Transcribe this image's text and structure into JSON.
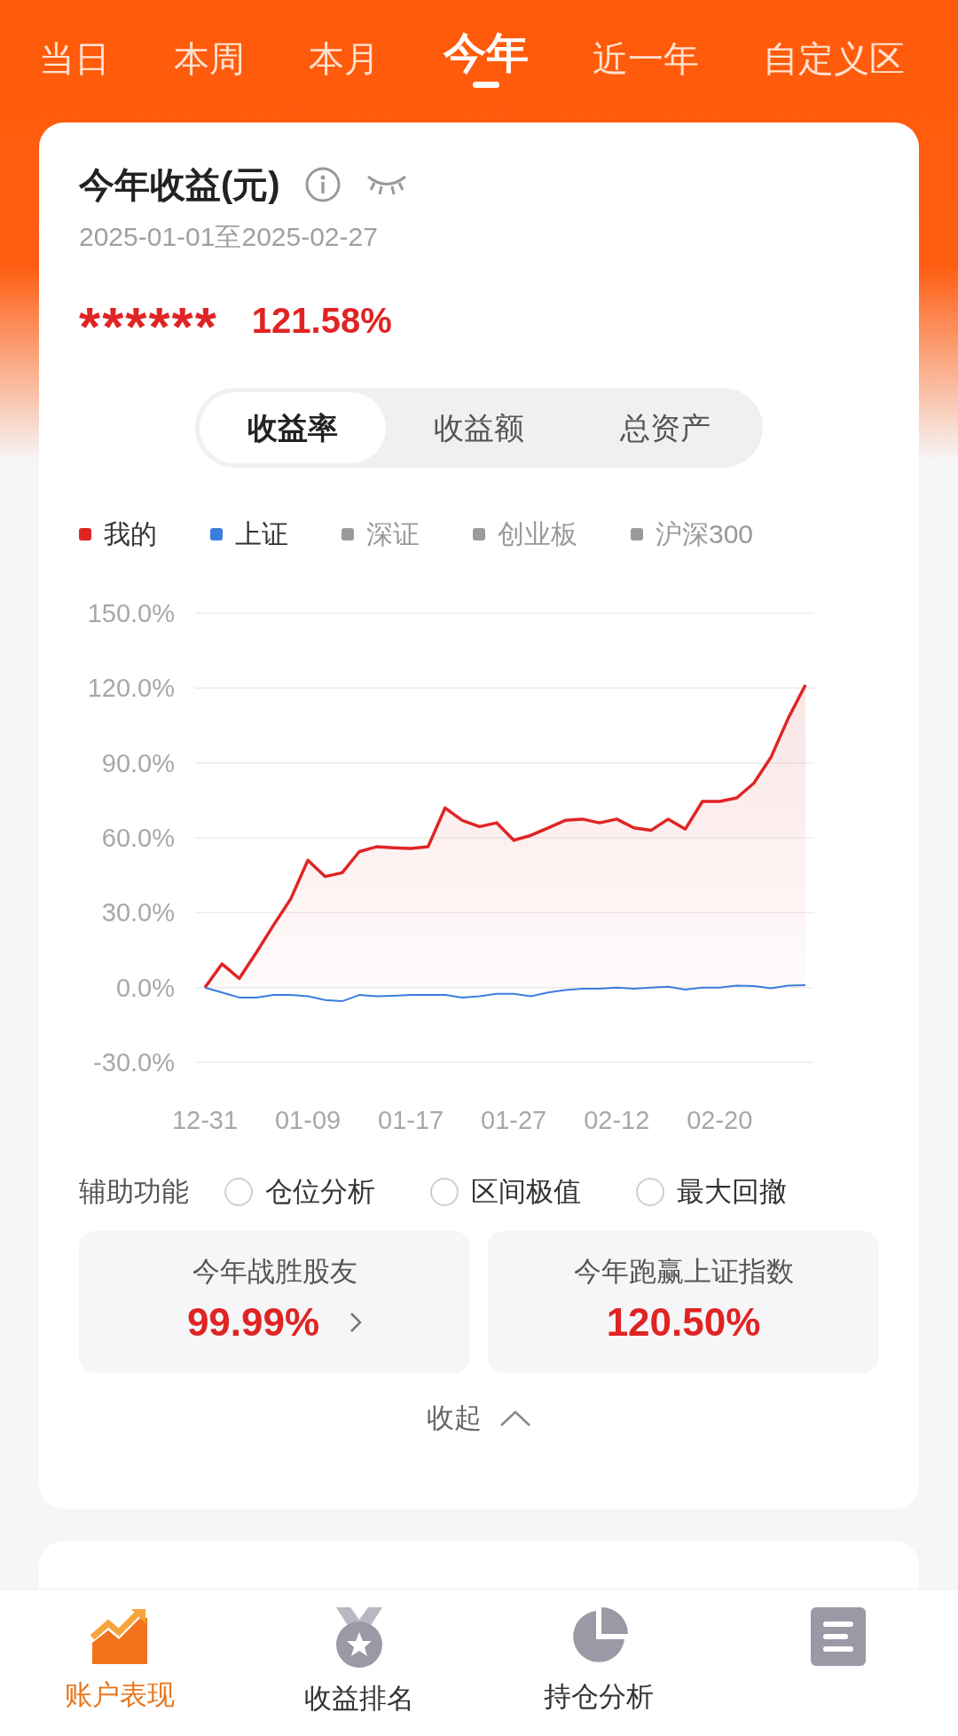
{
  "period_tabs": [
    {
      "label": "当日",
      "selected": false
    },
    {
      "label": "本周",
      "selected": false
    },
    {
      "label": "本月",
      "selected": false
    },
    {
      "label": "今年",
      "selected": true
    },
    {
      "label": "近一年",
      "selected": false
    },
    {
      "label": "自定义区",
      "selected": false
    }
  ],
  "summary": {
    "title": "今年收益(元)",
    "date_range": "2025-01-01至2025-02-27",
    "amount": "******",
    "rate": "121.58%"
  },
  "metric_tabs": [
    {
      "label": "收益率",
      "selected": true
    },
    {
      "label": "收益额",
      "selected": false
    },
    {
      "label": "总资产",
      "selected": false
    }
  ],
  "legend": [
    {
      "label": "深证",
      "color": "#9a9a9a"
    },
    {
      "label": "创业板",
      "color": "#9a9a9a"
    },
    {
      "label": "沪深300",
      "color": "#9a9a9a"
    }
  ],
  "chart": {
    "chart_data": {
      "type": "line",
      "grid": true,
      "categories": [
        "12-31",
        null,
        null,
        null,
        null,
        null,
        "01-09",
        null,
        null,
        null,
        null,
        null,
        "01-17",
        null,
        null,
        null,
        null,
        null,
        "01-27",
        null,
        null,
        null,
        null,
        null,
        "02-12",
        null,
        null,
        null,
        null,
        null,
        "02-20",
        null,
        null,
        null,
        null,
        null
      ],
      "ylim": [
        -30,
        150
      ],
      "yticks": [
        {
          "value": 150,
          "label": "150.0%"
        },
        {
          "value": 120,
          "label": "120.0%"
        },
        {
          "value": 90,
          "label": "90.0%"
        },
        {
          "value": 60,
          "label": "60.0%"
        },
        {
          "value": 30,
          "label": "30.0%"
        },
        {
          "value": 0,
          "label": "0.0%"
        },
        {
          "value": -30,
          "label": "-30.0%"
        }
      ],
      "series": [
        {
          "name": "我的",
          "type": "area",
          "color": "#e02424",
          "values": [
            0,
            9.5,
            3.6,
            14,
            25,
            35.5,
            51,
            44.5,
            46,
            54.5,
            56.4,
            56,
            55.7,
            56.4,
            72,
            67,
            64.5,
            66,
            59,
            61,
            64,
            67,
            67.5,
            66,
            67.5,
            64,
            63,
            67.5,
            63.5,
            74.6,
            74.6,
            76,
            82,
            92.4,
            108,
            121.3
          ]
        },
        {
          "name": "上证",
          "type": "line",
          "color": "#3b7ddd",
          "values": [
            0,
            -2,
            -4,
            -4,
            -3,
            -3,
            -3.5,
            -5,
            -5.5,
            -3,
            -3.5,
            -3.3,
            -3,
            -3,
            -3,
            -4,
            -3.5,
            -2.5,
            -2.5,
            -3.5,
            -2,
            -1,
            -0.5,
            -0.5,
            0,
            -0.5,
            0,
            0.3,
            -0.8,
            0,
            0,
            0.8,
            0.6,
            -0.3,
            0.8,
            1
          ]
        }
      ]
    }
  },
  "aux": {
    "label": "辅助功能",
    "options": [
      {
        "label": "仓位分析",
        "checked": false
      },
      {
        "label": "区间极值",
        "checked": false
      },
      {
        "label": "最大回撤",
        "checked": false
      }
    ]
  },
  "stats": [
    {
      "label": "今年战胜股友",
      "value": "99.99%",
      "link": true
    },
    {
      "label": "今年跑赢上证指数",
      "value": "120.50%",
      "link": false
    }
  ],
  "collapse": "收起",
  "bottom_nav": [
    {
      "kind": "trend",
      "label": "账户表现",
      "selected": true
    },
    {
      "kind": "medal",
      "label": "收益排名",
      "selected": false
    },
    {
      "kind": "pie",
      "label": "持仓分析",
      "selected": false
    },
    {
      "kind": "document",
      "selected": false
    }
  ]
}
